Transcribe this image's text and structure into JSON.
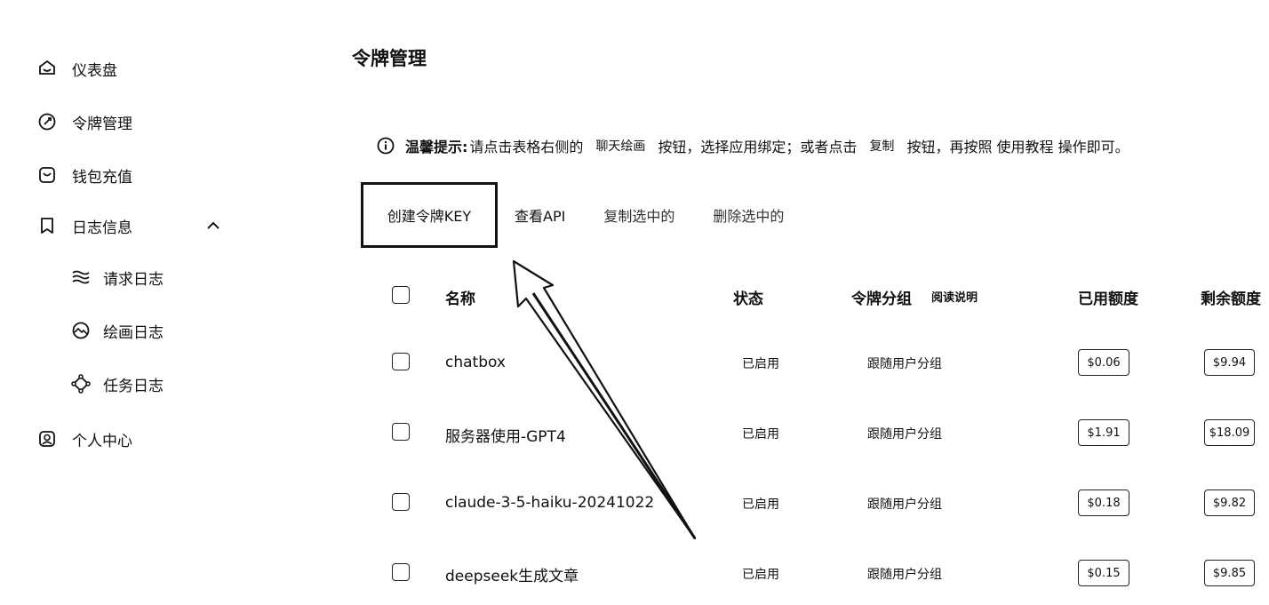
{
  "sidebar": {
    "items": [
      {
        "label": "仪表盘",
        "icon": "dashboard-icon"
      },
      {
        "label": "令牌管理",
        "icon": "key-icon"
      },
      {
        "label": "钱包充值",
        "icon": "wallet-icon"
      },
      {
        "label": "日志信息",
        "icon": "bookmark-icon",
        "expanded": true
      },
      {
        "label": "个人中心",
        "icon": "user-icon"
      }
    ],
    "sub_items": [
      {
        "label": "请求日志",
        "icon": "waves-icon"
      },
      {
        "label": "绘画日志",
        "icon": "image-icon"
      },
      {
        "label": "任务日志",
        "icon": "task-icon"
      }
    ]
  },
  "page": {
    "title": "令牌管理"
  },
  "notice": {
    "strong": "温馨提示:",
    "part1": "请点击表格右侧的",
    "chip1": "聊天绘画",
    "part2": "按钮，选择应用绑定；或者点击",
    "chip2": "复制",
    "part3": "按钮，再按照 使用教程 操作即可。"
  },
  "toolbar": {
    "create": "创建令牌KEY",
    "view_api": "查看API",
    "copy_selected": "复制选中的",
    "delete_selected": "删除选中的"
  },
  "table": {
    "headers": {
      "name": "名称",
      "status": "状态",
      "group": "令牌分组",
      "group_help": "阅读说明",
      "used": "已用额度",
      "remaining": "剩余额度"
    },
    "rows": [
      {
        "name": "chatbox",
        "status": "已启用",
        "group": "跟随用户分组",
        "used": "$0.06",
        "remaining": "$9.94"
      },
      {
        "name": "服务器使用-GPT4",
        "status": "已启用",
        "group": "跟随用户分组",
        "used": "$1.91",
        "remaining": "$18.09"
      },
      {
        "name": "claude-3-5-haiku-20241022",
        "status": "已启用",
        "group": "跟随用户分组",
        "used": "$0.18",
        "remaining": "$9.82"
      },
      {
        "name": "deepseek生成文章",
        "status": "已启用",
        "group": "跟随用户分组",
        "used": "$0.15",
        "remaining": "$9.85"
      }
    ]
  }
}
